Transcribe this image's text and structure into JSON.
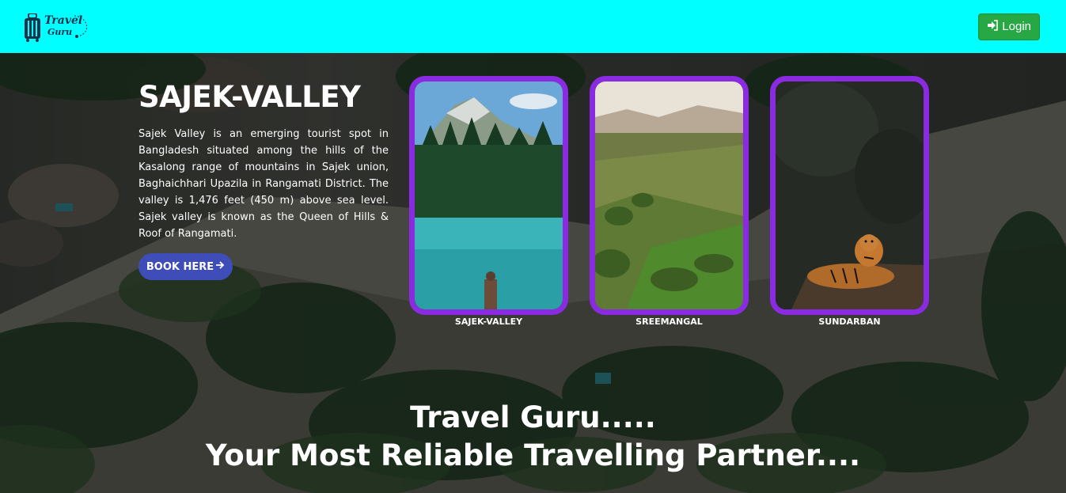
{
  "navbar": {
    "logo_line1": "Travel",
    "logo_line2": "Guru",
    "login_label": "Login",
    "login_icon": "sign-in-icon",
    "background_color": "#00ffff",
    "login_color": "#28a745"
  },
  "hero": {
    "title": "SAJEK-VALLEY",
    "description": "Sajek Valley is an emerging tourist spot in Bangladesh situated among the hills of the Kasalong range of mountains in Sajek union, Baghaichhari Upazila in Rangamati District. The valley is 1,476 feet (450 m) above sea level. Sajek valley is known as the Queen of Hills & Roof of Rangamati.",
    "book_label": "BOOK HERE",
    "book_icon": "arrow-right-icon",
    "book_color": "#3e4db8"
  },
  "cards": [
    {
      "label": "SAJEK-VALLEY"
    },
    {
      "label": "SREEMANGAL"
    },
    {
      "label": "SUNDARBAN"
    }
  ],
  "card_border_color": "#8a2be2",
  "tagline": {
    "line1": "Travel Guru.....",
    "line2": "Your Most Reliable Travelling Partner...."
  }
}
